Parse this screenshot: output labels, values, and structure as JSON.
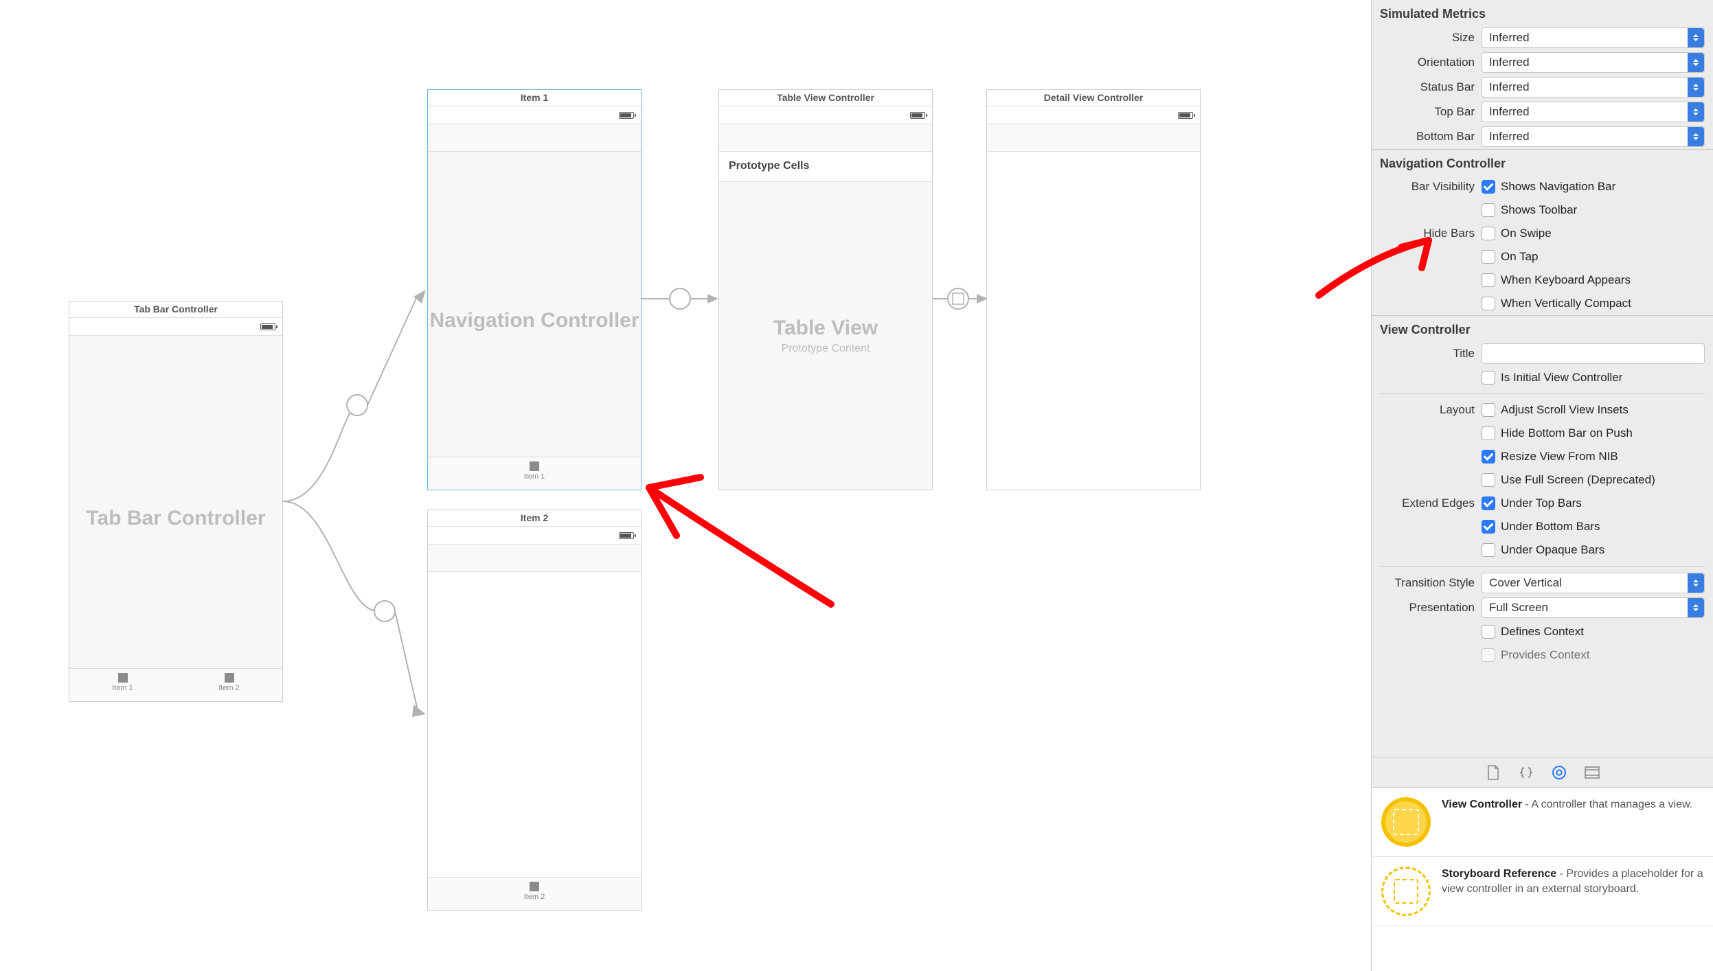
{
  "canvas": {
    "scenes": {
      "tabbar": {
        "title": "Tab Bar Controller",
        "placeholder": "Tab Bar Controller",
        "tabs": [
          "Item 1",
          "Item 2"
        ]
      },
      "nav1": {
        "title": "Item 1",
        "placeholder": "Navigation Controller",
        "tabLabel": "Item 1"
      },
      "nav2": {
        "title": "Item 2",
        "tabLabel": "Item 2"
      },
      "table": {
        "title": "Table View Controller",
        "protoHeader": "Prototype Cells",
        "placeholderBig": "Table View",
        "placeholderSub": "Prototype Content"
      },
      "detail": {
        "title": "Detail View Controller"
      }
    }
  },
  "inspector": {
    "simulatedMetrics": {
      "title": "Simulated Metrics",
      "rows": {
        "size": {
          "label": "Size",
          "value": "Inferred"
        },
        "orientation": {
          "label": "Orientation",
          "value": "Inferred"
        },
        "statusbar": {
          "label": "Status Bar",
          "value": "Inferred"
        },
        "topbar": {
          "label": "Top Bar",
          "value": "Inferred"
        },
        "bottombar": {
          "label": "Bottom Bar",
          "value": "Inferred"
        }
      }
    },
    "navController": {
      "title": "Navigation Controller",
      "barVisibilityLabel": "Bar Visibility",
      "hideBarsLabel": "Hide Bars",
      "checks": {
        "showsNav": {
          "label": "Shows Navigation Bar",
          "checked": true
        },
        "showsToolbar": {
          "label": "Shows Toolbar",
          "checked": false
        },
        "onSwipe": {
          "label": "On Swipe",
          "checked": false
        },
        "onTap": {
          "label": "On Tap",
          "checked": false
        },
        "keyboard": {
          "label": "When Keyboard Appears",
          "checked": false
        },
        "vertCompact": {
          "label": "When Vertically Compact",
          "checked": false
        }
      }
    },
    "viewController": {
      "title": "View Controller",
      "titleLabel": "Title",
      "titleValue": "",
      "isInitial": {
        "label": "Is Initial View Controller",
        "checked": false
      },
      "layoutLabel": "Layout",
      "layout": {
        "adjustInsets": {
          "label": "Adjust Scroll View Insets",
          "checked": false
        },
        "hideBottom": {
          "label": "Hide Bottom Bar on Push",
          "checked": false
        },
        "resizeNib": {
          "label": "Resize View From NIB",
          "checked": true
        },
        "fullscreenD": {
          "label": "Use Full Screen (Deprecated)",
          "checked": false
        }
      },
      "extendEdgesLabel": "Extend Edges",
      "extendEdges": {
        "underTop": {
          "label": "Under Top Bars",
          "checked": true
        },
        "underBottom": {
          "label": "Under Bottom Bars",
          "checked": true
        },
        "underOpaque": {
          "label": "Under Opaque Bars",
          "checked": false
        }
      },
      "transition": {
        "label": "Transition Style",
        "value": "Cover Vertical"
      },
      "presentation": {
        "label": "Presentation",
        "value": "Full Screen"
      },
      "definesContext": {
        "label": "Defines Context",
        "checked": false
      },
      "providesContext": {
        "label": "Provides Context",
        "checked": false
      }
    }
  },
  "library": {
    "items": {
      "vc": {
        "title": "View Controller",
        "desc": " - A controller that manages a view."
      },
      "sbref": {
        "title": "Storyboard Reference",
        "desc": " - Provides a placeholder for a view controller in an external storyboard."
      }
    }
  }
}
